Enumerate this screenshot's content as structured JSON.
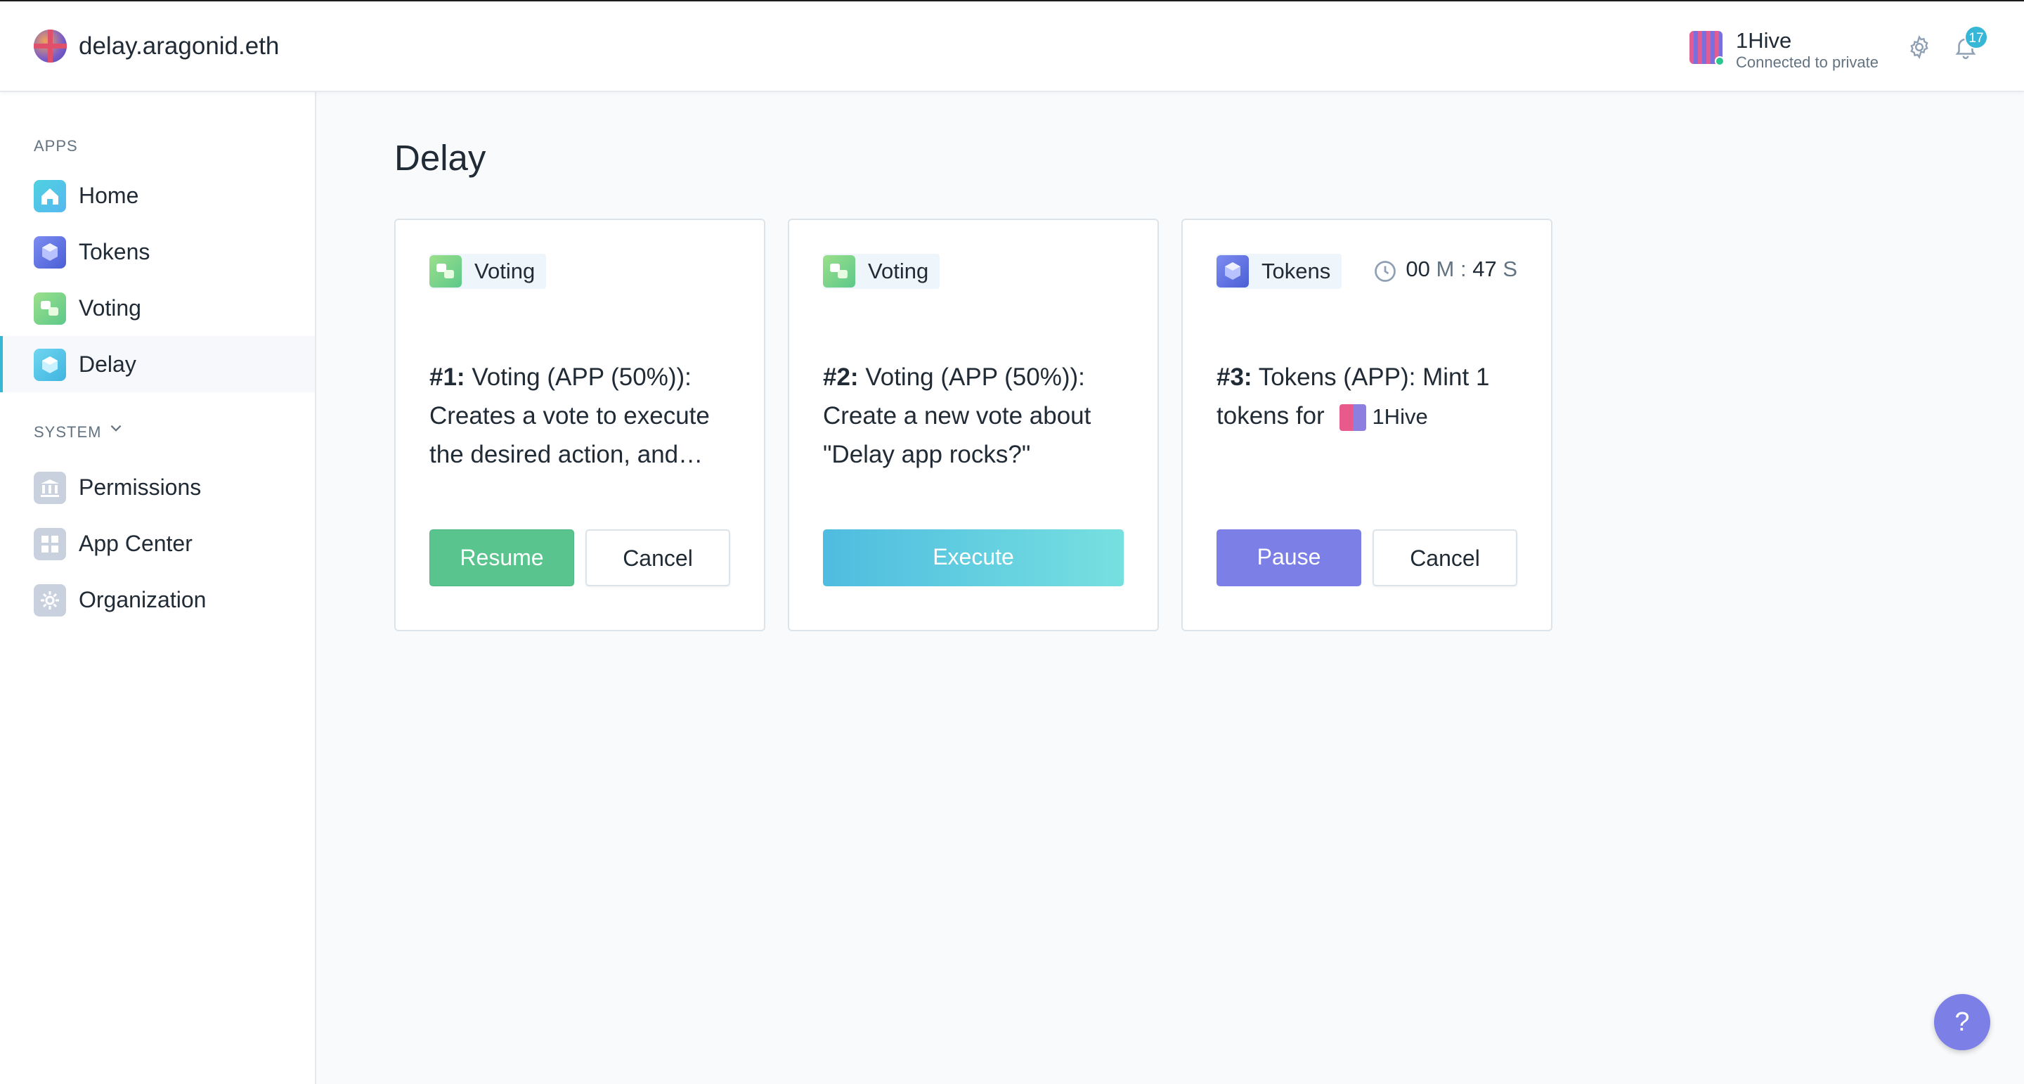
{
  "header": {
    "org_name": "delay.aragonid.eth",
    "account_name": "1Hive",
    "account_status": "Connected to private",
    "notification_count": "17",
    "settings_icon": "gear-icon",
    "notifications_icon": "bell-icon"
  },
  "sidebar": {
    "apps_label": "APPS",
    "apps": [
      {
        "label": "Home",
        "icon": "home-icon"
      },
      {
        "label": "Tokens",
        "icon": "tokens-icon"
      },
      {
        "label": "Voting",
        "icon": "voting-icon"
      },
      {
        "label": "Delay",
        "icon": "delay-icon",
        "active": true
      }
    ],
    "system_label": "SYSTEM",
    "system": [
      {
        "label": "Permissions",
        "icon": "permissions-icon"
      },
      {
        "label": "App Center",
        "icon": "app-center-icon"
      },
      {
        "label": "Organization",
        "icon": "organization-icon"
      }
    ]
  },
  "main": {
    "title": "Delay",
    "cards": [
      {
        "app": "Voting",
        "number": "#1:",
        "text": "Voting (APP (50%)): Creates a vote to execute the desired action, and…",
        "buttons": [
          "Resume",
          "Cancel"
        ]
      },
      {
        "app": "Voting",
        "number": "#2:",
        "text": "Voting (APP (50%)): Create a new vote about \"Delay app rocks?\"",
        "buttons": [
          "Execute"
        ]
      },
      {
        "app": "Tokens",
        "number": "#3:",
        "text": "Tokens (APP): Mint 1 tokens for",
        "recipient": "1Hive",
        "timer": {
          "minutes": "00",
          "minutes_unit": "M",
          "separator": ":",
          "seconds": "47",
          "seconds_unit": "S"
        },
        "buttons": [
          "Pause",
          "Cancel"
        ]
      }
    ]
  },
  "help_label": "?",
  "colors": {
    "accent": "#37b6d6",
    "resume": "#5ac48e",
    "pause": "#7b7fe6",
    "execute_start": "#4fbce0",
    "execute_end": "#76e0e0"
  }
}
